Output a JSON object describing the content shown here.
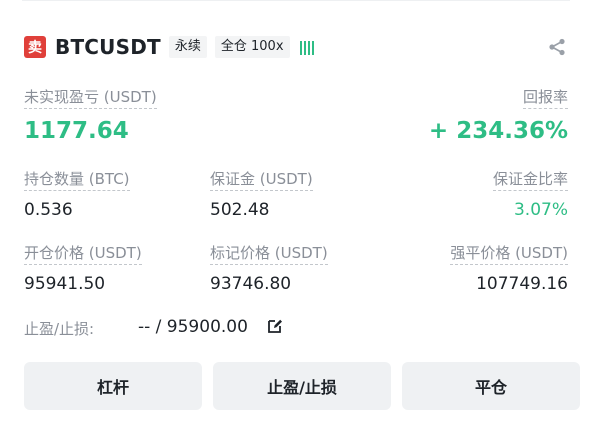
{
  "header": {
    "side_badge": "卖",
    "symbol": "BTCUSDT",
    "contract_type": "永续",
    "margin_mode": "全仓 100x",
    "leverage_icon": "leverage-bars-icon",
    "share_icon": "share-icon"
  },
  "pnl": {
    "label": "未实现盈亏 (USDT)",
    "value": "1177.64",
    "roe_label": "回报率",
    "roe_value": "+ 234.36%"
  },
  "stats_row1": [
    {
      "label": "持仓数量 (BTC)",
      "value": "0.536"
    },
    {
      "label": "保证金 (USDT)",
      "value": "502.48"
    },
    {
      "label": "保证金比率",
      "value": "3.07%"
    }
  ],
  "stats_row2": [
    {
      "label": "开仓价格 (USDT)",
      "value": "95941.50"
    },
    {
      "label": "标记价格 (USDT)",
      "value": "93746.80"
    },
    {
      "label": "强平价格 (USDT)",
      "value": "107749.16"
    }
  ],
  "tpsl": {
    "label": "止盈/止损:",
    "value": "-- / 95900.00",
    "edit_icon": "edit-icon"
  },
  "buttons": {
    "leverage": "杠杆",
    "tpsl": "止盈/止损",
    "close": "平仓"
  },
  "colors": {
    "positive": "#2ebd85",
    "sell_badge": "#e0403a",
    "label_gray": "#8a8f98",
    "button_bg": "#eff1f3"
  }
}
